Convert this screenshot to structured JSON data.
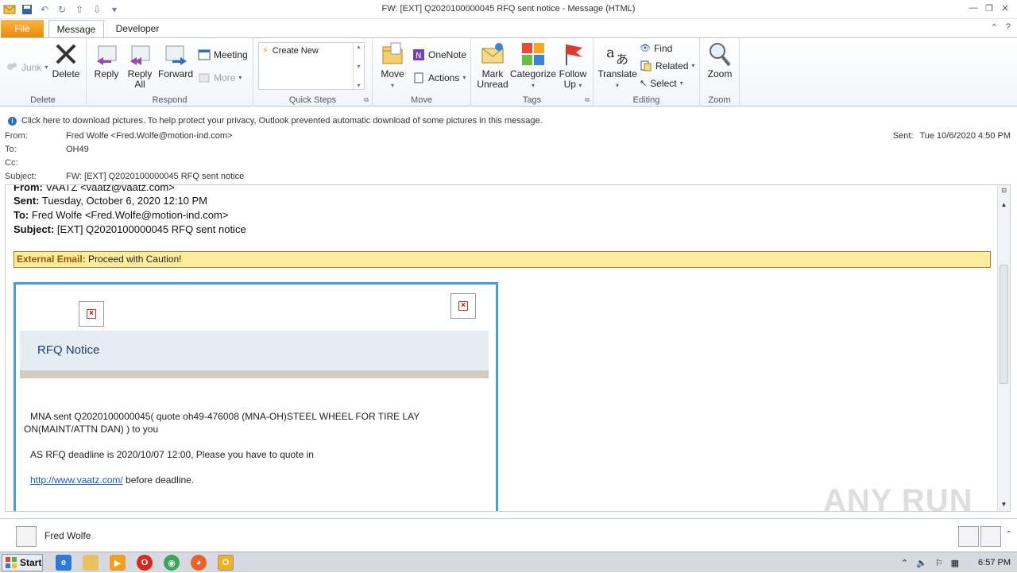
{
  "window": {
    "title": "FW: [EXT] Q2020100000045 RFQ sent notice  -  Message (HTML)"
  },
  "tabs": {
    "file": "File",
    "message": "Message",
    "developer": "Developer"
  },
  "ribbon": {
    "delete_group": {
      "label": "Delete",
      "junk": "Junk",
      "delete": "Delete"
    },
    "respond_group": {
      "label": "Respond",
      "reply": "Reply",
      "reply_all_1": "Reply",
      "reply_all_2": "All",
      "forward": "Forward",
      "meeting": "Meeting",
      "more": "More"
    },
    "quick_steps_group": {
      "label": "Quick Steps",
      "create_new": "Create New"
    },
    "move_group": {
      "label": "Move",
      "move": "Move",
      "onenote": "OneNote",
      "actions": "Actions"
    },
    "tags_group": {
      "label": "Tags",
      "mark_unread_1": "Mark",
      "mark_unread_2": "Unread",
      "categorize": "Categorize",
      "follow_up_1": "Follow",
      "follow_up_2": "Up"
    },
    "editing_group": {
      "label": "Editing",
      "translate": "Translate",
      "find": "Find",
      "related": "Related",
      "select": "Select"
    },
    "zoom_group": {
      "label": "Zoom",
      "zoom": "Zoom"
    }
  },
  "infobar": {
    "text": "Click here to download pictures. To help protect your privacy, Outlook prevented automatic download of some pictures in this message."
  },
  "header": {
    "from_label": "From:",
    "from": "Fred Wolfe <Fred.Wolfe@motion-ind.com>",
    "to_label": "To:",
    "to": "OH49",
    "cc_label": "Cc:",
    "cc": "",
    "subject_label": "Subject:",
    "subject": "FW: [EXT] Q2020100000045 RFQ sent notice",
    "sent_label": "Sent:",
    "sent": "Tue 10/6/2020 4:50 PM"
  },
  "body": {
    "fwd_from_label": "From:",
    "fwd_from": "VAATZ <vaatz@vaatz.com>",
    "fwd_sent_label": "Sent:",
    "fwd_sent": "Tuesday, October 6, 2020 12:10 PM",
    "fwd_to_label": "To:",
    "fwd_to": "Fred Wolfe <Fred.Wolfe@motion-ind.com>",
    "fwd_subject_label": "Subject:",
    "fwd_subject": "[EXT] Q2020100000045 RFQ sent notice",
    "external_label": "External Email:",
    "external_text": "Proceed with Caution!",
    "rfq_title": "RFQ Notice",
    "line1": "MNA sent Q2020100000045( quote oh49-476008 (MNA-OH)STEEL WHEEL FOR TIRE LAY",
    "line2": "ON(MAINT/ATTN DAN) ) to you",
    "line3": "AS RFQ deadline is 2020/10/07 12:00, Please you have to quote in",
    "link": "http://www.vaatz.com/",
    "line4": " before deadline."
  },
  "people_pane": {
    "name": "Fred Wolfe"
  },
  "taskbar": {
    "start": "Start",
    "clock": "6:57 PM"
  },
  "watermark": "ANY RUN",
  "colors": {
    "accent": "#4aa0c8",
    "file_tab": "#f7a21b",
    "warning_bg": "#ffeb9c"
  }
}
